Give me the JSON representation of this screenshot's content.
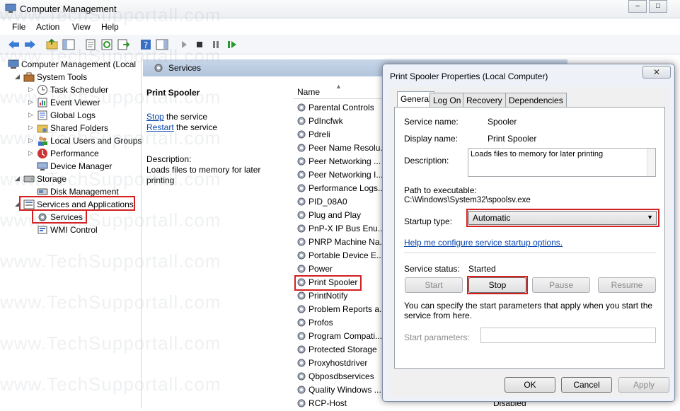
{
  "window": {
    "title": "Computer Management"
  },
  "menu": [
    "File",
    "Action",
    "View",
    "Help"
  ],
  "tree": [
    {
      "label": "Computer Management (Local"
    },
    {
      "label": "System Tools"
    },
    {
      "label": "Task Scheduler"
    },
    {
      "label": "Event Viewer"
    },
    {
      "label": "Global Logs"
    },
    {
      "label": "Shared Folders"
    },
    {
      "label": "Local Users and Groups"
    },
    {
      "label": "Performance"
    },
    {
      "label": "Device Manager"
    },
    {
      "label": "Storage"
    },
    {
      "label": "Disk Management"
    },
    {
      "label": "Services and Applications"
    },
    {
      "label": "Services"
    },
    {
      "label": "WMI Control"
    }
  ],
  "services_panel": {
    "header": "Services",
    "selected_name": "Print Spooler",
    "stop_link": "Stop",
    "stop_suffix": "the service",
    "restart_link": "Restart",
    "restart_suffix": "the service",
    "description_label": "Description:",
    "description_text": "Loads files to memory for later printing",
    "column_name": "Name",
    "items": [
      "Parental Controls",
      "PdIncfwk",
      "Pdreli",
      "Peer Name Resolu...",
      "Peer Networking ...",
      "Peer Networking I...",
      "Performance Logs...",
      "PID_08A0",
      "Plug and Play",
      "PnP-X IP Bus Enu...",
      "PNRP Machine Na...",
      "Portable Device E...",
      "Power",
      "Print Spooler",
      "PrintNotify",
      "Problem Reports a...",
      "Profos",
      "Program Compati...",
      "Protected Storage",
      "Proxyhostdriver",
      "Qbposdbservices",
      "Quality Windows ...",
      "RCP-Host"
    ],
    "last_row_status": "Disabled"
  },
  "dialog": {
    "title": "Print Spooler Properties (Local Computer)",
    "tabs": [
      "General",
      "Log On",
      "Recovery",
      "Dependencies"
    ],
    "service_name_label": "Service name:",
    "service_name": "Spooler",
    "display_name_label": "Display name:",
    "display_name": "Print Spooler",
    "description_label": "Description:",
    "description": "Loads files to memory for later printing",
    "path_label": "Path to executable:",
    "path": "C:\\Windows\\System32\\spoolsv.exe",
    "startup_type_label": "Startup type:",
    "startup_type": "Automatic",
    "help_link": "Help me configure service startup options.",
    "status_label": "Service status:",
    "status": "Started",
    "buttons": {
      "start": "Start",
      "stop": "Stop",
      "pause": "Pause",
      "resume": "Resume"
    },
    "params_note": "You can specify the start parameters that apply when you start the service from here.",
    "params_label": "Start parameters:",
    "footer": {
      "ok": "OK",
      "cancel": "Cancel",
      "apply": "Apply"
    }
  },
  "watermark": "www.TechSupportall.com",
  "colors": {
    "highlight_red": "#d42020",
    "link_blue": "#0645ad",
    "header_blue": "#b9cbe1"
  }
}
